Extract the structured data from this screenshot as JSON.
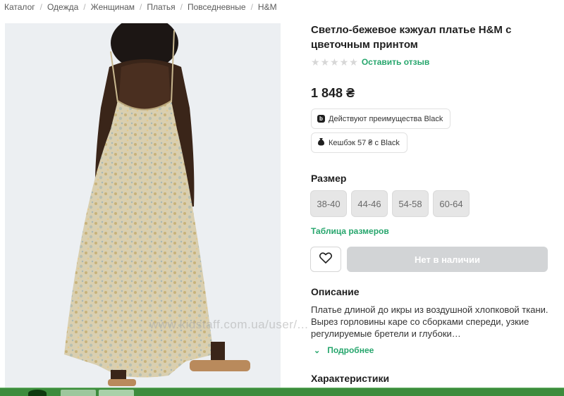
{
  "breadcrumb": [
    "Каталог",
    "Одежда",
    "Женщинам",
    "Платья",
    "Повседневные",
    "H&M"
  ],
  "product": {
    "title": "Светло-бежевое кэжуал платье H&M с цветочным принтом",
    "review_link": "Оставить отзыв",
    "rating_stars": 0,
    "price": "1 848 ₴",
    "badges": {
      "black_benefits": "Действуют преимущества Black",
      "cashback": "Кешбэк 57 ₴ с Black"
    }
  },
  "size": {
    "label": "Размер",
    "options": [
      "38-40",
      "44-46",
      "54-58",
      "60-64"
    ],
    "table_link": "Таблица размеров"
  },
  "actions": {
    "favorite_icon": "heart-icon",
    "buy_label": "Нет в наличии"
  },
  "description": {
    "heading": "Описание",
    "text": "Платье длиной до икры из воздушной хлопковой ткани. Вырез горловины каре со сборками спереди, узкие регулируемые бретели и глубоки…",
    "more_label": "Подробнее"
  },
  "characteristics": {
    "heading": "Характеристики"
  },
  "watermark": "www.kidstaff.com.ua/user/...",
  "colors": {
    "accent": "#27a66d",
    "disabled_button": "#d2d4d6",
    "chip_bg": "#e6e6e6",
    "taskbar": "#3d8c3d"
  }
}
